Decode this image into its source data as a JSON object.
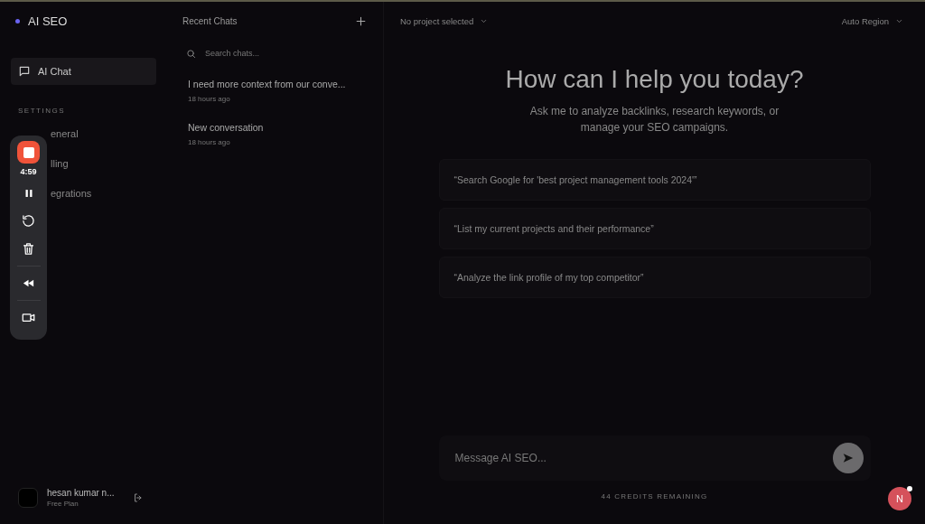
{
  "brand": {
    "name": "AI SEO"
  },
  "nav": [
    {
      "label": "AI Chat",
      "selected": true
    }
  ],
  "settings": {
    "heading": "SETTINGS",
    "items": [
      {
        "label": "eneral",
        "selected": false
      },
      {
        "label": "lling",
        "selected": false
      },
      {
        "label": "egrations",
        "selected": false
      }
    ]
  },
  "user": {
    "name": "hesan kumar n...",
    "plan": "Free Plan"
  },
  "recorder": {
    "time": "4:59"
  },
  "chats": {
    "title": "Recent Chats",
    "search": {
      "placeholder": "Search chats..."
    },
    "items": [
      {
        "title": "I need more context from our conve...",
        "time": "18 hours ago",
        "selected": false
      },
      {
        "title": "New conversation",
        "time": "18 hours ago",
        "selected": false
      }
    ]
  },
  "header": {
    "project": "No project selected",
    "region": "Auto Region"
  },
  "hero": {
    "title": "How can I help you today?",
    "subtitle": "Ask me to analyze backlinks, research keywords, or manage your SEO campaigns."
  },
  "suggestions": [
    "“Search Google for 'best project management tools 2024'”",
    "“List my current projects and their performance”",
    "“Analyze the link profile of my top competitor”"
  ],
  "composer": {
    "placeholder": "Message AI SEO..."
  },
  "credits": "44 CREDITS REMAINING",
  "badge": {
    "letter": "N"
  }
}
